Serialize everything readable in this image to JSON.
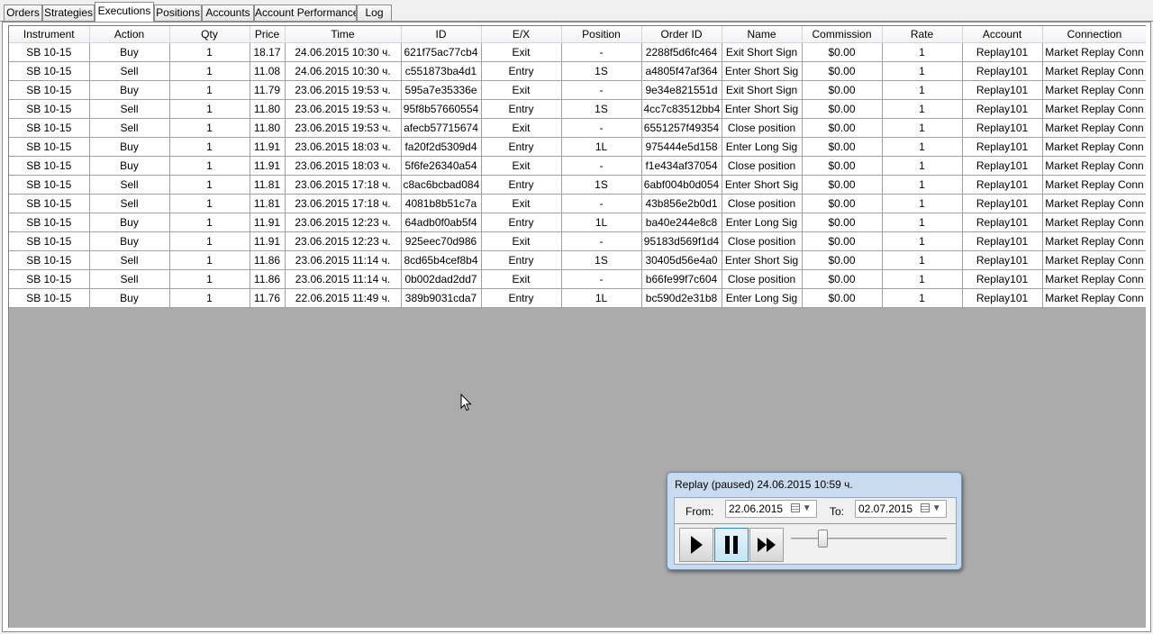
{
  "tabs": [
    {
      "label": "Orders"
    },
    {
      "label": "Strategies"
    },
    {
      "label": "Executions"
    },
    {
      "label": "Positions"
    },
    {
      "label": "Accounts"
    },
    {
      "label": "Account Performance"
    },
    {
      "label": "Log"
    }
  ],
  "active_tab": "Executions",
  "table": {
    "columns": [
      "Instrument",
      "Action",
      "Qty",
      "Price",
      "Time",
      "ID",
      "E/X",
      "Position",
      "Order ID",
      "Name",
      "Commission",
      "Rate",
      "Account",
      "Connection"
    ],
    "rows": [
      [
        "SB 10-15",
        "Buy",
        "1",
        "18.17",
        "24.06.2015 10:30 ч.",
        "621f75ac77cb4",
        "Exit",
        "-",
        "2288f5d6fc464",
        "Exit Short Sign",
        "$0.00",
        "1",
        "Replay101",
        "Market Replay Conn"
      ],
      [
        "SB 10-15",
        "Sell",
        "1",
        "11.08",
        "24.06.2015 10:30 ч.",
        "c551873ba4d1",
        "Entry",
        "1S",
        "a4805f47af364",
        "Enter Short Sig",
        "$0.00",
        "1",
        "Replay101",
        "Market Replay Conn"
      ],
      [
        "SB 10-15",
        "Buy",
        "1",
        "11.79",
        "23.06.2015 19:53 ч.",
        "595a7e35336e",
        "Exit",
        "-",
        "9e34e821551d",
        "Exit Short Sign",
        "$0.00",
        "1",
        "Replay101",
        "Market Replay Conn"
      ],
      [
        "SB 10-15",
        "Sell",
        "1",
        "11.80",
        "23.06.2015 19:53 ч.",
        "95f8b57660554",
        "Entry",
        "1S",
        "4cc7c83512bb4",
        "Enter Short Sig",
        "$0.00",
        "1",
        "Replay101",
        "Market Replay Conn"
      ],
      [
        "SB 10-15",
        "Sell",
        "1",
        "11.80",
        "23.06.2015 19:53 ч.",
        "afecb57715674",
        "Exit",
        "-",
        "6551257f49354",
        "Close position",
        "$0.00",
        "1",
        "Replay101",
        "Market Replay Conn"
      ],
      [
        "SB 10-15",
        "Buy",
        "1",
        "11.91",
        "23.06.2015 18:03 ч.",
        "fa20f2d5309d4",
        "Entry",
        "1L",
        "975444e5d158",
        "Enter Long Sig",
        "$0.00",
        "1",
        "Replay101",
        "Market Replay Conn"
      ],
      [
        "SB 10-15",
        "Buy",
        "1",
        "11.91",
        "23.06.2015 18:03 ч.",
        "5f6fe26340a54",
        "Exit",
        "-",
        "f1e434af37054",
        "Close position",
        "$0.00",
        "1",
        "Replay101",
        "Market Replay Conn"
      ],
      [
        "SB 10-15",
        "Sell",
        "1",
        "11.81",
        "23.06.2015 17:18 ч.",
        "c8ac6bcbad084",
        "Entry",
        "1S",
        "6abf004b0d054",
        "Enter Short Sig",
        "$0.00",
        "1",
        "Replay101",
        "Market Replay Conn"
      ],
      [
        "SB 10-15",
        "Sell",
        "1",
        "11.81",
        "23.06.2015 17:18 ч.",
        "4081b8b51c7a",
        "Exit",
        "-",
        "43b856e2b0d1",
        "Close position",
        "$0.00",
        "1",
        "Replay101",
        "Market Replay Conn"
      ],
      [
        "SB 10-15",
        "Buy",
        "1",
        "11.91",
        "23.06.2015 12:23 ч.",
        "64adb0f0ab5f4",
        "Entry",
        "1L",
        "ba40e244e8c8",
        "Enter Long Sig",
        "$0.00",
        "1",
        "Replay101",
        "Market Replay Conn"
      ],
      [
        "SB 10-15",
        "Buy",
        "1",
        "11.91",
        "23.06.2015 12:23 ч.",
        "925eec70d986",
        "Exit",
        "-",
        "95183d569f1d4",
        "Close position",
        "$0.00",
        "1",
        "Replay101",
        "Market Replay Conn"
      ],
      [
        "SB 10-15",
        "Sell",
        "1",
        "11.86",
        "23.06.2015 11:14 ч.",
        "8cd65b4cef8b4",
        "Entry",
        "1S",
        "30405d56e4a0",
        "Enter Short Sig",
        "$0.00",
        "1",
        "Replay101",
        "Market Replay Conn"
      ],
      [
        "SB 10-15",
        "Sell",
        "1",
        "11.86",
        "23.06.2015 11:14 ч.",
        "0b002dad2dd7",
        "Exit",
        "-",
        "b66fe99f7c604",
        "Close position",
        "$0.00",
        "1",
        "Replay101",
        "Market Replay Conn"
      ],
      [
        "SB 10-15",
        "Buy",
        "1",
        "11.76",
        "22.06.2015 11:49 ч.",
        "389b9031cda7",
        "Entry",
        "1L",
        "bc590d2e31b8",
        "Enter Long Sig",
        "$0.00",
        "1",
        "Replay101",
        "Market Replay Conn"
      ]
    ]
  },
  "replay": {
    "title": "Replay (paused) 24.06.2015 10:59 ч.",
    "from_label": "From:",
    "from_value": "22.06.2015",
    "to_label": "To:",
    "to_value": "02.07.2015",
    "play_icon": "play-icon",
    "pause_icon": "pause-icon",
    "fast_forward_icon": "fast-forward-icon",
    "speed_fraction": 0.2
  }
}
